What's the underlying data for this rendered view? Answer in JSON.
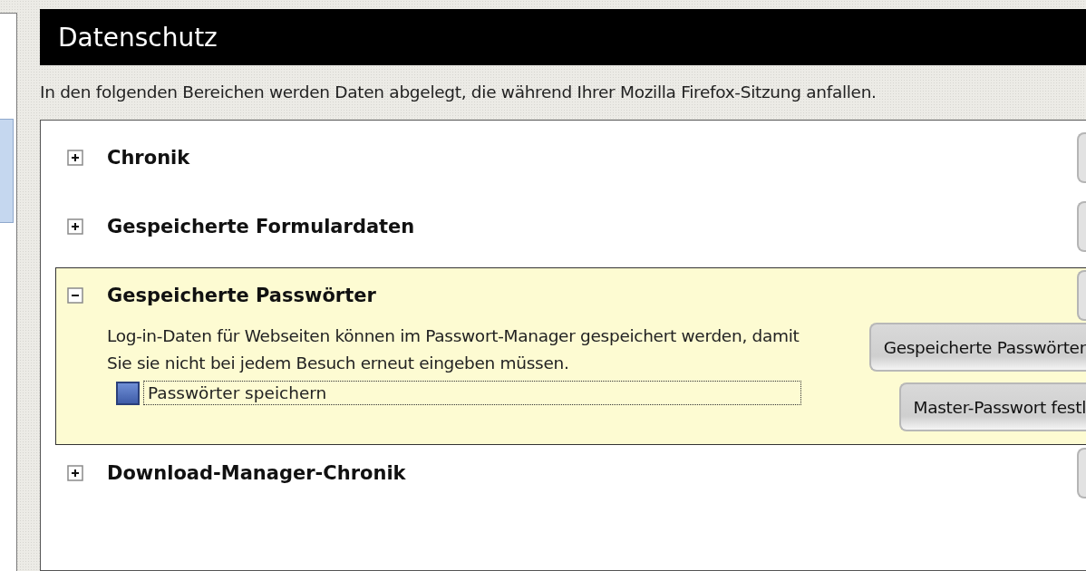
{
  "header": {
    "title": "Datenschutz"
  },
  "description": "In den folgenden Bereichen werden Daten abgelegt, die während Ihrer Mozilla Firefox-Sitzung anfallen.",
  "sidebar": {
    "items": [
      {
        "selected": true
      }
    ]
  },
  "sections": [
    {
      "title": "Chronik",
      "expanded": false
    },
    {
      "title": "Gespeicherte Formulardaten",
      "expanded": false
    },
    {
      "title": "Gespeicherte Passwörter",
      "expanded": true,
      "text": "Log-in-Daten für Webseiten können im Passwort-Manager gespeichert werden, damit Sie sie nicht bei jedem Besuch erneut eingeben müssen.",
      "checkbox": {
        "label": "Passwörter speichern",
        "checked": true
      },
      "buttons": [
        "Gespeicherte Passwörter",
        "Master-Passwort festl"
      ]
    },
    {
      "title": "Download-Manager-Chronik",
      "expanded": false
    }
  ]
}
